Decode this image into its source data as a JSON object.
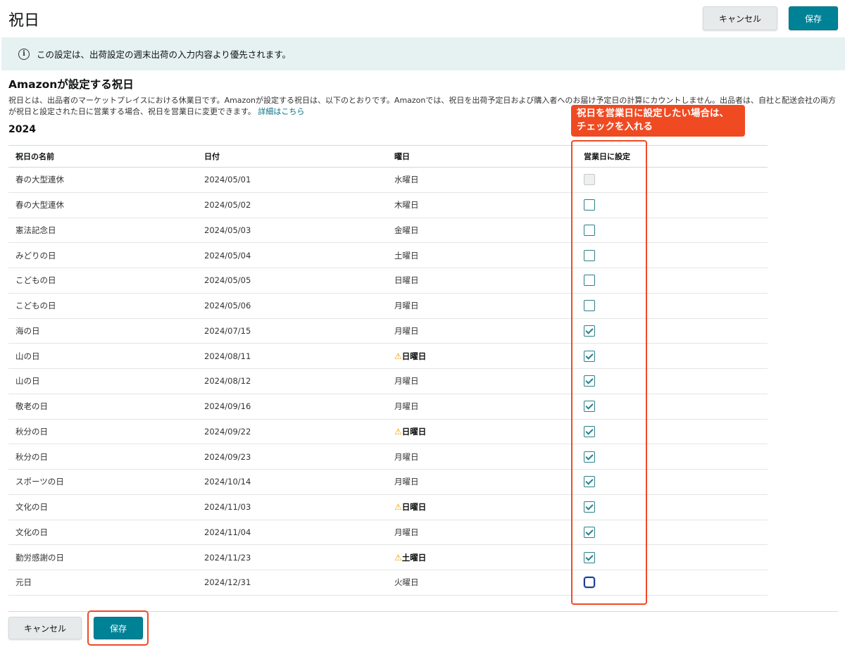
{
  "header": {
    "title": "祝日",
    "cancel_label": "キャンセル",
    "save_label": "保存"
  },
  "banner": {
    "icon": "i",
    "text": "この設定は、出荷設定の週末出荷の入力内容より優先されます。"
  },
  "section": {
    "title": "Amazonが設定する祝日",
    "description": "祝日とは、出品者のマーケットプレイスにおける休業日です。Amazonが設定する祝日は、以下のとおりです。Amazonでは、祝日を出荷予定日および購入者へのお届け予定日の計算にカウントしません。出品者は、自社と配送会社の両方が祝日と設定された日に営業する場合、祝日を営業日に変更できます。",
    "link_text": "詳細はこちら"
  },
  "year": "2024",
  "table": {
    "headers": {
      "name": "祝日の名前",
      "date": "日付",
      "dow": "曜日",
      "business_day": "営業日に設定"
    },
    "rows": [
      {
        "name": "春の大型連休",
        "date": "2024/05/01",
        "dow": "水曜日",
        "warning": false,
        "checked": false,
        "disabled": true
      },
      {
        "name": "春の大型連休",
        "date": "2024/05/02",
        "dow": "木曜日",
        "warning": false,
        "checked": false,
        "disabled": false
      },
      {
        "name": "憲法記念日",
        "date": "2024/05/03",
        "dow": "金曜日",
        "warning": false,
        "checked": false,
        "disabled": false
      },
      {
        "name": "みどりの日",
        "date": "2024/05/04",
        "dow": "土曜日",
        "warning": false,
        "checked": false,
        "disabled": false
      },
      {
        "name": "こどもの日",
        "date": "2024/05/05",
        "dow": "日曜日",
        "warning": false,
        "checked": false,
        "disabled": false
      },
      {
        "name": "こどもの日",
        "date": "2024/05/06",
        "dow": "月曜日",
        "warning": false,
        "checked": false,
        "disabled": false
      },
      {
        "name": "海の日",
        "date": "2024/07/15",
        "dow": "月曜日",
        "warning": false,
        "checked": true,
        "disabled": false
      },
      {
        "name": "山の日",
        "date": "2024/08/11",
        "dow": "日曜日",
        "warning": true,
        "checked": true,
        "disabled": false
      },
      {
        "name": "山の日",
        "date": "2024/08/12",
        "dow": "月曜日",
        "warning": false,
        "checked": true,
        "disabled": false
      },
      {
        "name": "敬老の日",
        "date": "2024/09/16",
        "dow": "月曜日",
        "warning": false,
        "checked": true,
        "disabled": false
      },
      {
        "name": "秋分の日",
        "date": "2024/09/22",
        "dow": "日曜日",
        "warning": true,
        "checked": true,
        "disabled": false
      },
      {
        "name": "秋分の日",
        "date": "2024/09/23",
        "dow": "月曜日",
        "warning": false,
        "checked": true,
        "disabled": false
      },
      {
        "name": "スポーツの日",
        "date": "2024/10/14",
        "dow": "月曜日",
        "warning": false,
        "checked": true,
        "disabled": false
      },
      {
        "name": "文化の日",
        "date": "2024/11/03",
        "dow": "日曜日",
        "warning": true,
        "checked": true,
        "disabled": false
      },
      {
        "name": "文化の日",
        "date": "2024/11/04",
        "dow": "月曜日",
        "warning": false,
        "checked": true,
        "disabled": false
      },
      {
        "name": "勤労感謝の日",
        "date": "2024/11/23",
        "dow": "土曜日",
        "warning": true,
        "checked": true,
        "disabled": false
      },
      {
        "name": "元日",
        "date": "2024/12/31",
        "dow": "火曜日",
        "warning": false,
        "checked": false,
        "disabled": false,
        "focused": true
      }
    ]
  },
  "annotation": {
    "callout_line1": "祝日を営業日に設定したい場合は、",
    "callout_line2": "チェックを入れる",
    "highlight_color": "#f04a23"
  },
  "footer": {
    "cancel_label": "キャンセル",
    "save_label": "保存"
  },
  "colors": {
    "primary": "#008296",
    "banner_bg": "#e6f2f2",
    "link": "#007185",
    "warning": "#f0a000"
  }
}
